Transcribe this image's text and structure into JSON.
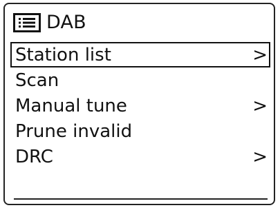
{
  "header": {
    "icon": "menu-list-icon",
    "title": "DAB"
  },
  "menu": {
    "items": [
      {
        "label": "Station list",
        "has_submenu": true,
        "arrow": ">",
        "selected": true
      },
      {
        "label": "Scan",
        "has_submenu": false,
        "arrow": "",
        "selected": false
      },
      {
        "label": "Manual tune",
        "has_submenu": true,
        "arrow": ">",
        "selected": false
      },
      {
        "label": "Prune invalid",
        "has_submenu": false,
        "arrow": "",
        "selected": false
      },
      {
        "label": "DRC",
        "has_submenu": true,
        "arrow": ">",
        "selected": false
      }
    ]
  }
}
